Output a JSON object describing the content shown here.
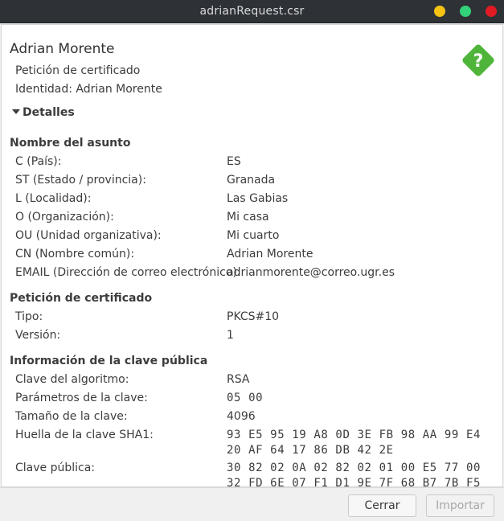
{
  "window": {
    "title": "adrianRequest.csr"
  },
  "header": {
    "name": "Adrian Morente",
    "type": "Petición de certificado",
    "identity": "Identidad: Adrian Morente",
    "details_label": "Detalles"
  },
  "subject": {
    "heading": "Nombre del asunto",
    "rows": [
      {
        "label": "C (País):",
        "value": "ES"
      },
      {
        "label": "ST (Estado / provincia):",
        "value": "Granada"
      },
      {
        "label": "L (Localidad):",
        "value": "Las Gabias"
      },
      {
        "label": "O (Organización):",
        "value": "Mi casa"
      },
      {
        "label": "OU (Unidad organizativa):",
        "value": "Mi cuarto"
      },
      {
        "label": "CN (Nombre común):",
        "value": "Adrian Morente"
      },
      {
        "label": "EMAIL (Dirección de correo electrónico):",
        "value": "adrianmorente@correo.ugr.es"
      }
    ]
  },
  "request": {
    "heading": "Petición de certificado",
    "rows": [
      {
        "label": "Tipo:",
        "value": "PKCS#10"
      },
      {
        "label": "Versión:",
        "value": "1"
      }
    ]
  },
  "pubkey": {
    "heading": "Información de la clave pública",
    "algorithm": {
      "label": "Clave del algoritmo:",
      "value": "RSA"
    },
    "params": {
      "label": "Parámetros de la clave:",
      "value": "05 00"
    },
    "size": {
      "label": "Tamaño de la clave:",
      "value": "4096"
    },
    "sha1": {
      "label": "Huella de la clave SHA1:",
      "line1": "93 E5 95 19 A8 0D 3E FB 98 AA 99 E4",
      "line2": "20 AF 64 17 86 DB 42 2E"
    },
    "key": {
      "label": "Clave pública:",
      "line1": "30 82 02 0A 02 82 02 01 00 E5 77 00",
      "line2": "32 FD 6E 07 F1 D1 9E 7F 68 B7 7B F5"
    }
  },
  "footer": {
    "cancel_label": "Cerrar",
    "import_label": "Importar"
  },
  "colors": {
    "help_icon": "#4eb53a",
    "titlebar": "#2e3136"
  },
  "icons": {
    "help": "question-diamond-icon",
    "expander": "triangle-down-icon"
  }
}
